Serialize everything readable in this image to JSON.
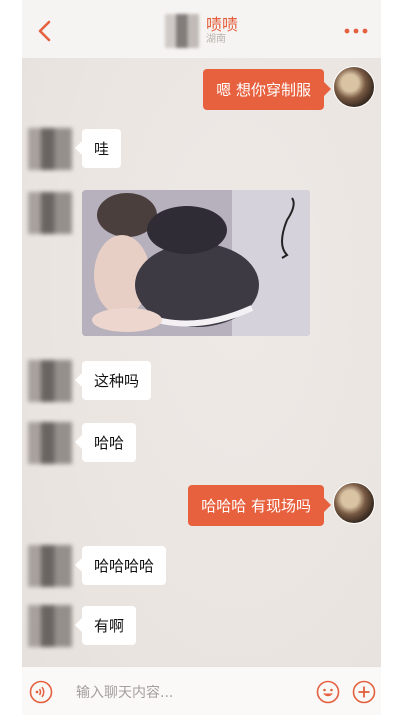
{
  "header": {
    "contact_name": "啧啧",
    "contact_status": "湖南",
    "back_icon": "chevron-left-icon",
    "more_icon": "more-dots-icon"
  },
  "messages": [
    {
      "side": "right",
      "type": "text",
      "text": "嗯 想你穿制服"
    },
    {
      "side": "left",
      "type": "text",
      "text": "哇"
    },
    {
      "side": "left",
      "type": "image",
      "description": "photo"
    },
    {
      "side": "left",
      "type": "text",
      "text": "这种吗"
    },
    {
      "side": "left",
      "type": "text",
      "text": "哈哈"
    },
    {
      "side": "right",
      "type": "text",
      "text": "哈哈哈 有现场吗"
    },
    {
      "side": "left",
      "type": "text",
      "text": "哈哈哈哈"
    },
    {
      "side": "left",
      "type": "text",
      "text": "有啊"
    }
  ],
  "input_bar": {
    "placeholder": "输入聊天内容...",
    "voice_icon": "voice-icon",
    "emoji_icon": "emoji-icon",
    "plus_icon": "plus-icon"
  },
  "colors": {
    "accent": "#e8613f",
    "bubble_left": "#ffffff",
    "background": "#f3efec"
  }
}
